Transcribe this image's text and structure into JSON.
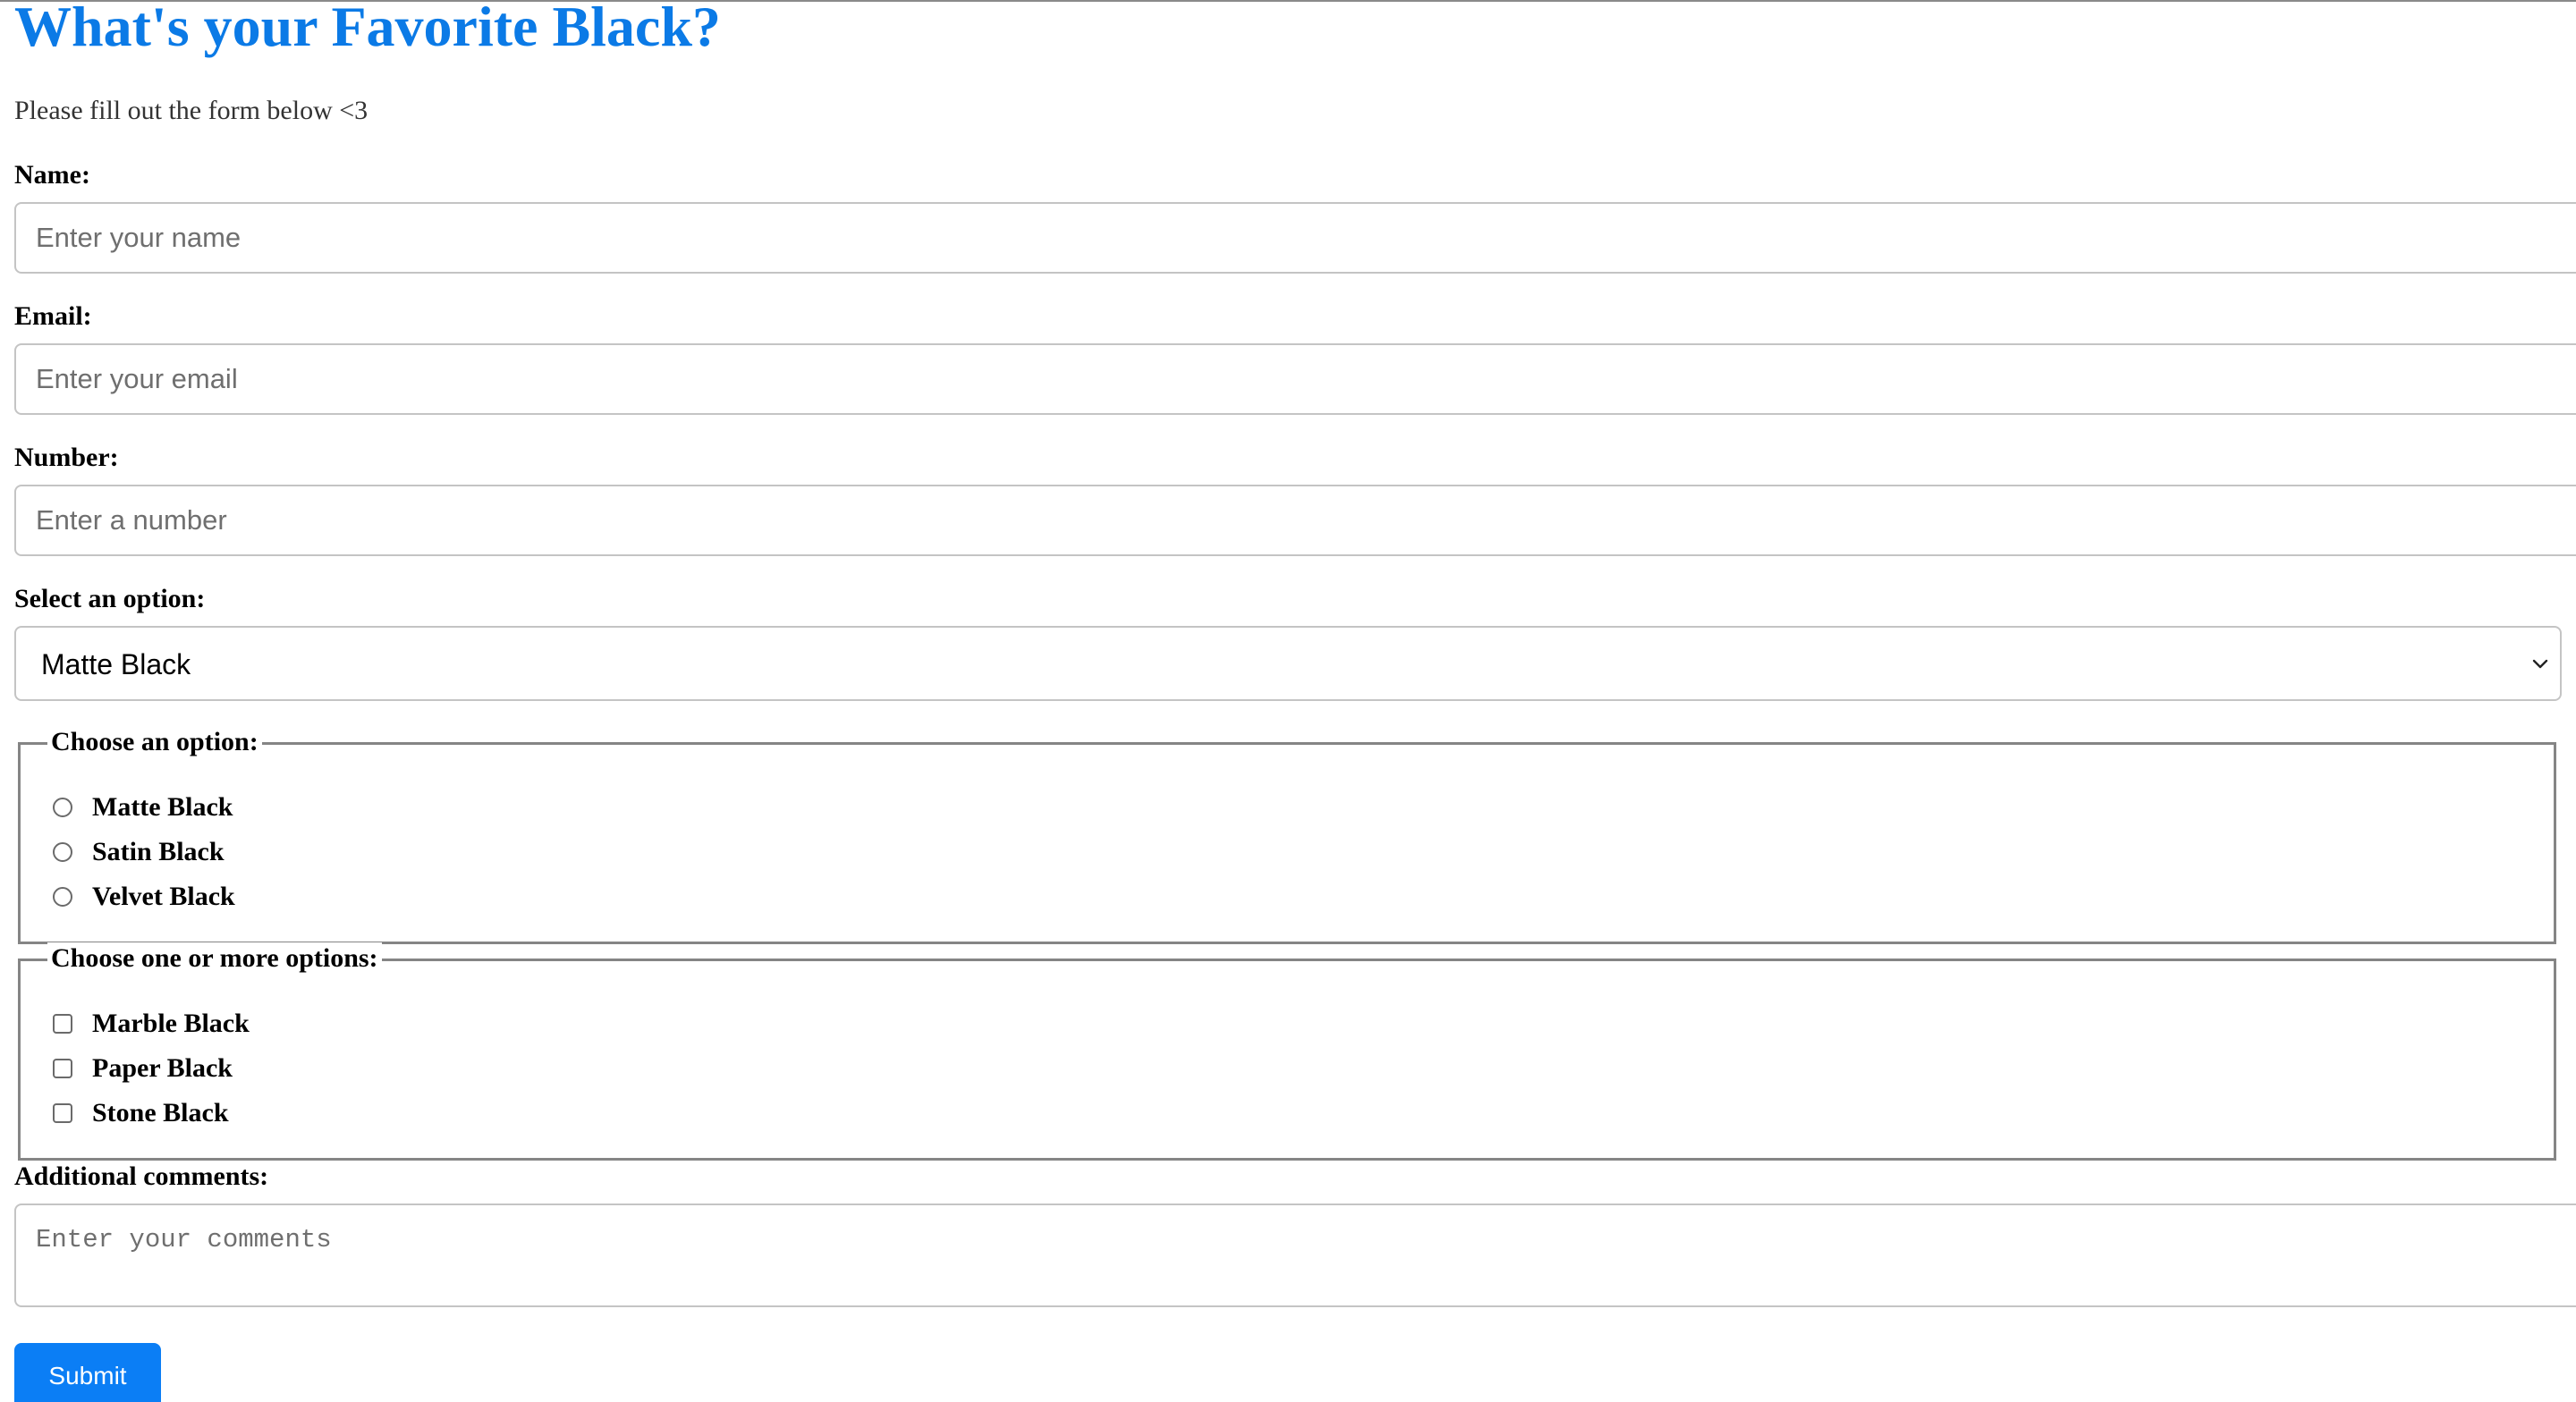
{
  "form": {
    "title": "What's your Favorite Black?",
    "subtitle": "Please fill out the form below <3",
    "name": {
      "label": "Name:",
      "placeholder": "Enter your name"
    },
    "email": {
      "label": "Email:",
      "placeholder": "Enter your email"
    },
    "number": {
      "label": "Number:",
      "placeholder": "Enter a number"
    },
    "select": {
      "label": "Select an option:",
      "selected": "Matte Black",
      "icon": "chevron-down-icon"
    },
    "radio_group": {
      "legend": "Choose an option:",
      "options": [
        "Matte Black",
        "Satin Black",
        "Velvet Black"
      ]
    },
    "checkbox_group": {
      "legend": "Choose one or more options:",
      "options": [
        "Marble Black",
        "Paper Black",
        "Stone Black"
      ]
    },
    "comments": {
      "label": "Additional comments:",
      "placeholder": "Enter your comments"
    },
    "submit_label": "Submit"
  },
  "colors": {
    "title": "#0b7ae6",
    "button": "#0b7ef5",
    "input_border": "#c4c4c4",
    "fieldset_border": "#858585"
  }
}
